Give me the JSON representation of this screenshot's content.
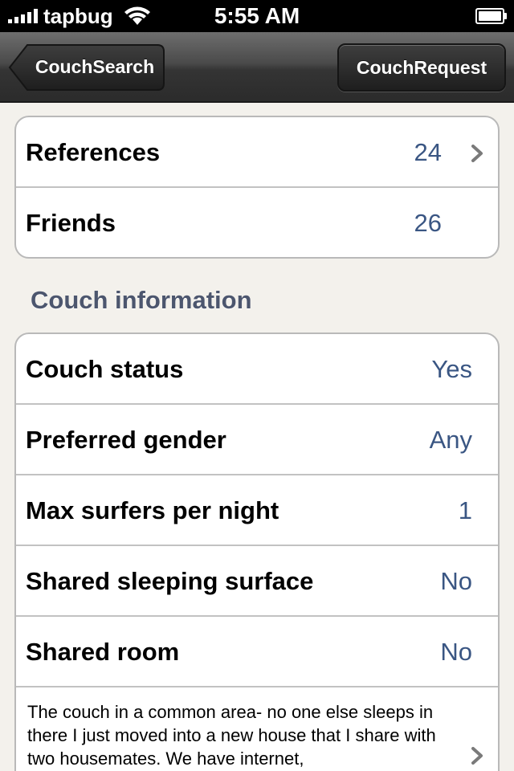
{
  "status_bar": {
    "carrier": "tapbug",
    "time": "5:55 AM"
  },
  "nav": {
    "back_label": "CouchSearch",
    "right_label": "CouchRequest"
  },
  "stats": [
    {
      "label": "References",
      "value": "24"
    },
    {
      "label": "Friends",
      "value": "26"
    }
  ],
  "couch": {
    "section_title": "Couch information",
    "rows": [
      {
        "label": "Couch status",
        "value": "Yes"
      },
      {
        "label": "Preferred gender",
        "value": "Any"
      },
      {
        "label": "Max surfers per night",
        "value": "1"
      },
      {
        "label": "Shared sleeping surface",
        "value": "No"
      },
      {
        "label": "Shared room",
        "value": "No"
      }
    ],
    "description": "The couch in a common area- no one else sleeps in there I just moved into a new house that I share with two housemates. We have internet,"
  },
  "colors": {
    "value_blue": "#3a5683",
    "section_header": "#4c566e",
    "background": "#f3f1ec"
  }
}
